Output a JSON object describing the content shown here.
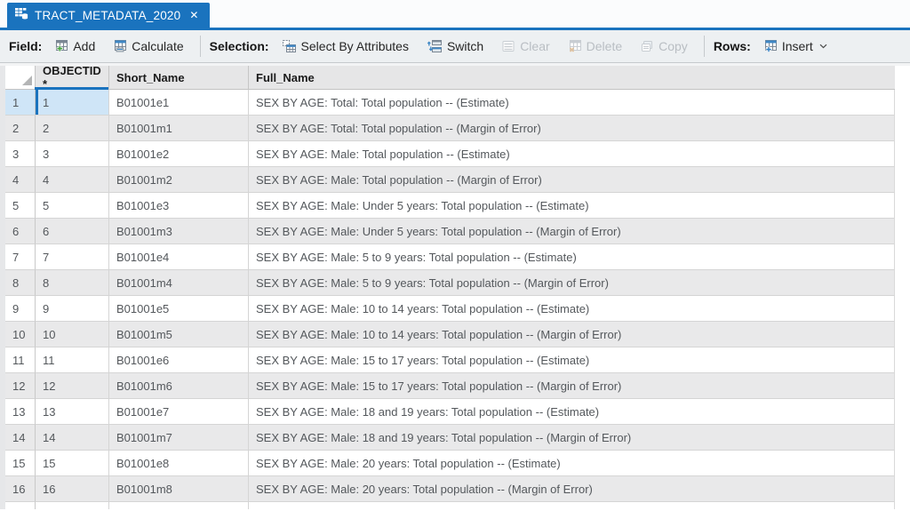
{
  "tab": {
    "title": "TRACT_METADATA_2020",
    "close_glyph": "✕"
  },
  "toolbar": {
    "field_label": "Field:",
    "add_label": "Add",
    "calculate_label": "Calculate",
    "selection_label": "Selection:",
    "select_by_attributes_label": "Select By Attributes",
    "switch_label": "Switch",
    "clear_label": "Clear",
    "delete_label": "Delete",
    "copy_label": "Copy",
    "rows_label": "Rows:",
    "insert_label": "Insert"
  },
  "table": {
    "columns": [
      "OBJECTID *",
      "Short_Name",
      "Full_Name"
    ],
    "rows": [
      {
        "n": "1",
        "objectid": "1",
        "short_name": "B01001e1",
        "full_name": "SEX BY AGE: Total: Total population -- (Estimate)"
      },
      {
        "n": "2",
        "objectid": "2",
        "short_name": "B01001m1",
        "full_name": "SEX BY AGE: Total: Total population -- (Margin of Error)"
      },
      {
        "n": "3",
        "objectid": "3",
        "short_name": "B01001e2",
        "full_name": "SEX BY AGE: Male: Total population -- (Estimate)"
      },
      {
        "n": "4",
        "objectid": "4",
        "short_name": "B01001m2",
        "full_name": "SEX BY AGE: Male: Total population -- (Margin of Error)"
      },
      {
        "n": "5",
        "objectid": "5",
        "short_name": "B01001e3",
        "full_name": "SEX BY AGE: Male: Under 5 years: Total population -- (Estimate)"
      },
      {
        "n": "6",
        "objectid": "6",
        "short_name": "B01001m3",
        "full_name": "SEX BY AGE: Male: Under 5 years: Total population -- (Margin of Error)"
      },
      {
        "n": "7",
        "objectid": "7",
        "short_name": "B01001e4",
        "full_name": "SEX BY AGE: Male: 5 to 9 years: Total population -- (Estimate)"
      },
      {
        "n": "8",
        "objectid": "8",
        "short_name": "B01001m4",
        "full_name": "SEX BY AGE: Male: 5 to 9 years: Total population -- (Margin of Error)"
      },
      {
        "n": "9",
        "objectid": "9",
        "short_name": "B01001e5",
        "full_name": "SEX BY AGE: Male: 10 to 14 years: Total population -- (Estimate)"
      },
      {
        "n": "10",
        "objectid": "10",
        "short_name": "B01001m5",
        "full_name": "SEX BY AGE: Male: 10 to 14 years: Total population -- (Margin of Error)"
      },
      {
        "n": "11",
        "objectid": "11",
        "short_name": "B01001e6",
        "full_name": "SEX BY AGE: Male: 15 to 17 years: Total population -- (Estimate)"
      },
      {
        "n": "12",
        "objectid": "12",
        "short_name": "B01001m6",
        "full_name": "SEX BY AGE: Male: 15 to 17 years: Total population -- (Margin of Error)"
      },
      {
        "n": "13",
        "objectid": "13",
        "short_name": "B01001e7",
        "full_name": "SEX BY AGE: Male: 18 and 19 years: Total population -- (Estimate)"
      },
      {
        "n": "14",
        "objectid": "14",
        "short_name": "B01001m7",
        "full_name": "SEX BY AGE: Male: 18 and 19 years: Total population -- (Margin of Error)"
      },
      {
        "n": "15",
        "objectid": "15",
        "short_name": "B01001e8",
        "full_name": "SEX BY AGE: Male: 20 years: Total population -- (Estimate)"
      },
      {
        "n": "16",
        "objectid": "16",
        "short_name": "B01001m8",
        "full_name": "SEX BY AGE: Male: 20 years: Total population -- (Margin of Error)"
      }
    ]
  },
  "colors": {
    "accent_blue": "#1a73be",
    "selection_fill": "#cfe5f7",
    "row_alt": "#e9e9ea",
    "header_fill": "#e6e6e7",
    "toolbar_fill": "#edf0f2"
  }
}
